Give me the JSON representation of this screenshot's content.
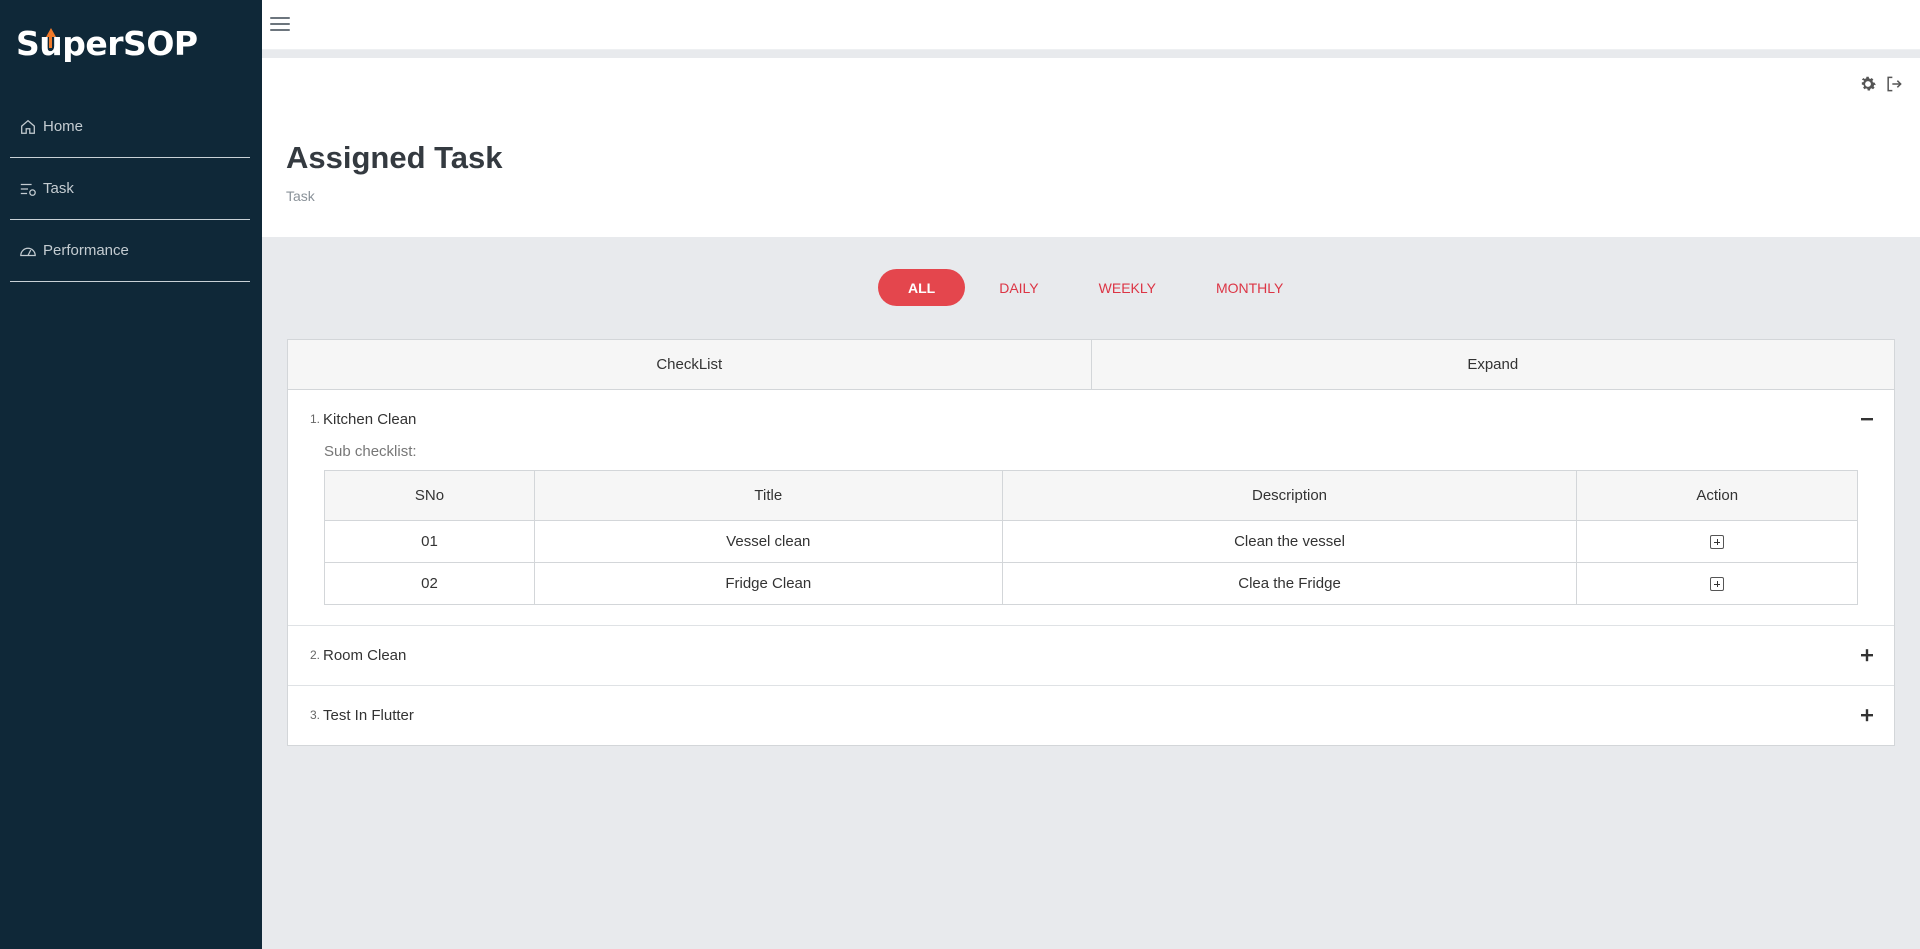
{
  "app": {
    "logo_prefix": "S",
    "logo_u": "u",
    "logo_suffix": "perSOP",
    "brand_color": "#e4464d",
    "sidebar_color": "#0f2838",
    "logo_accent": "#f07a2a"
  },
  "sidebar": {
    "items": [
      {
        "label": "Home",
        "icon": "home-icon"
      },
      {
        "label": "Task",
        "icon": "task-list-icon"
      },
      {
        "label": "Performance",
        "icon": "speedometer-icon"
      }
    ]
  },
  "toolbar": {
    "icons": [
      "menu-icon",
      "gear-icon",
      "logout-icon"
    ]
  },
  "header": {
    "title": "Assigned Task",
    "breadcrumb": "Task"
  },
  "filters": {
    "tabs": [
      {
        "label": "ALL",
        "active": true
      },
      {
        "label": "DAILY",
        "active": false
      },
      {
        "label": "WEEKLY",
        "active": false
      },
      {
        "label": "MONTHLY",
        "active": false
      }
    ]
  },
  "checklist_table": {
    "columns": [
      "CheckList",
      "Expand"
    ],
    "rows": [
      {
        "num": "1.",
        "title": "Kitchen Clean",
        "expanded": true,
        "sub_label": "Sub checklist:",
        "sub_columns": [
          "SNo",
          "Title",
          "Description",
          "Action"
        ],
        "sub_rows": [
          {
            "sno": "01",
            "title": "Vessel clean",
            "description": "Clean the vessel"
          },
          {
            "sno": "02",
            "title": "Fridge Clean",
            "description": "Clea the Fridge"
          }
        ]
      },
      {
        "num": "2.",
        "title": "Room Clean",
        "expanded": false
      },
      {
        "num": "3.",
        "title": "Test In Flutter",
        "expanded": false
      }
    ]
  }
}
